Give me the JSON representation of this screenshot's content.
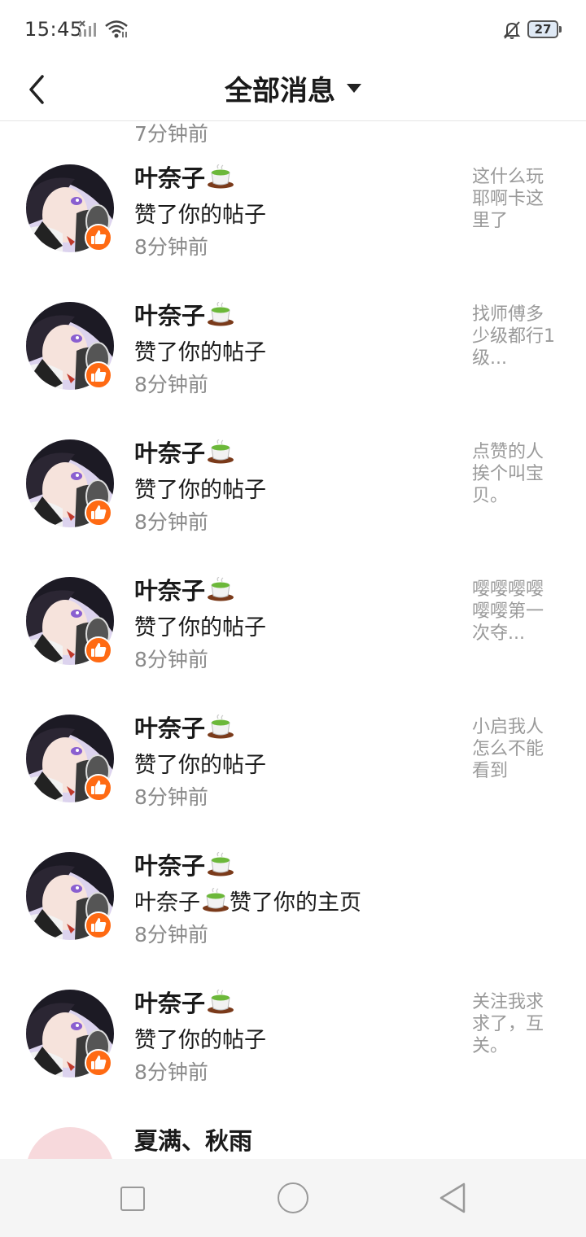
{
  "status_bar": {
    "time": "15:45",
    "battery": "27",
    "icons": [
      "signal-icon",
      "wifi-icon",
      "bell-muted-icon",
      "battery-icon"
    ]
  },
  "header": {
    "title": "全部消息",
    "back_icon": "chevron-left-icon",
    "dropdown_icon": "caret-down-icon"
  },
  "colors": {
    "like_badge": "#ff6a13",
    "muted_text": "#8a8a8a",
    "preview_text": "#9a9a9a",
    "nav_bg": "#f5f5f5"
  },
  "notifications": [
    {
      "name": "",
      "action": "",
      "time": "7分钟前",
      "preview": "",
      "partial": "top"
    },
    {
      "name": "叶奈子",
      "action": "赞了你的帖子",
      "time": "8分钟前",
      "preview": "这什么玩耶啊卡这里了"
    },
    {
      "name": "叶奈子",
      "action": "赞了你的帖子",
      "time": "8分钟前",
      "preview": "找师傅多少级都行1级..."
    },
    {
      "name": "叶奈子",
      "action": "赞了你的帖子",
      "time": "8分钟前",
      "preview": "点赞的人挨个叫宝贝。"
    },
    {
      "name": "叶奈子",
      "action": "赞了你的帖子",
      "time": "8分钟前",
      "preview": "嘤嘤嘤嘤嘤嘤第一次夺..."
    },
    {
      "name": "叶奈子",
      "action": "赞了你的帖子",
      "time": "8分钟前",
      "preview": "小启我人怎么不能看到"
    },
    {
      "name": "叶奈子",
      "action_prefix": "叶奈子",
      "action": "赞了你的主页",
      "time": "8分钟前",
      "preview": ""
    },
    {
      "name": "叶奈子",
      "action": "赞了你的帖子",
      "time": "8分钟前",
      "preview": "关注我求求了，互关。"
    },
    {
      "name": "夏满、秋雨",
      "action": "",
      "time": "",
      "preview": "",
      "partial": "bottom"
    }
  ],
  "navbar": {
    "buttons": [
      "recent-apps-button",
      "home-button",
      "back-button"
    ]
  }
}
